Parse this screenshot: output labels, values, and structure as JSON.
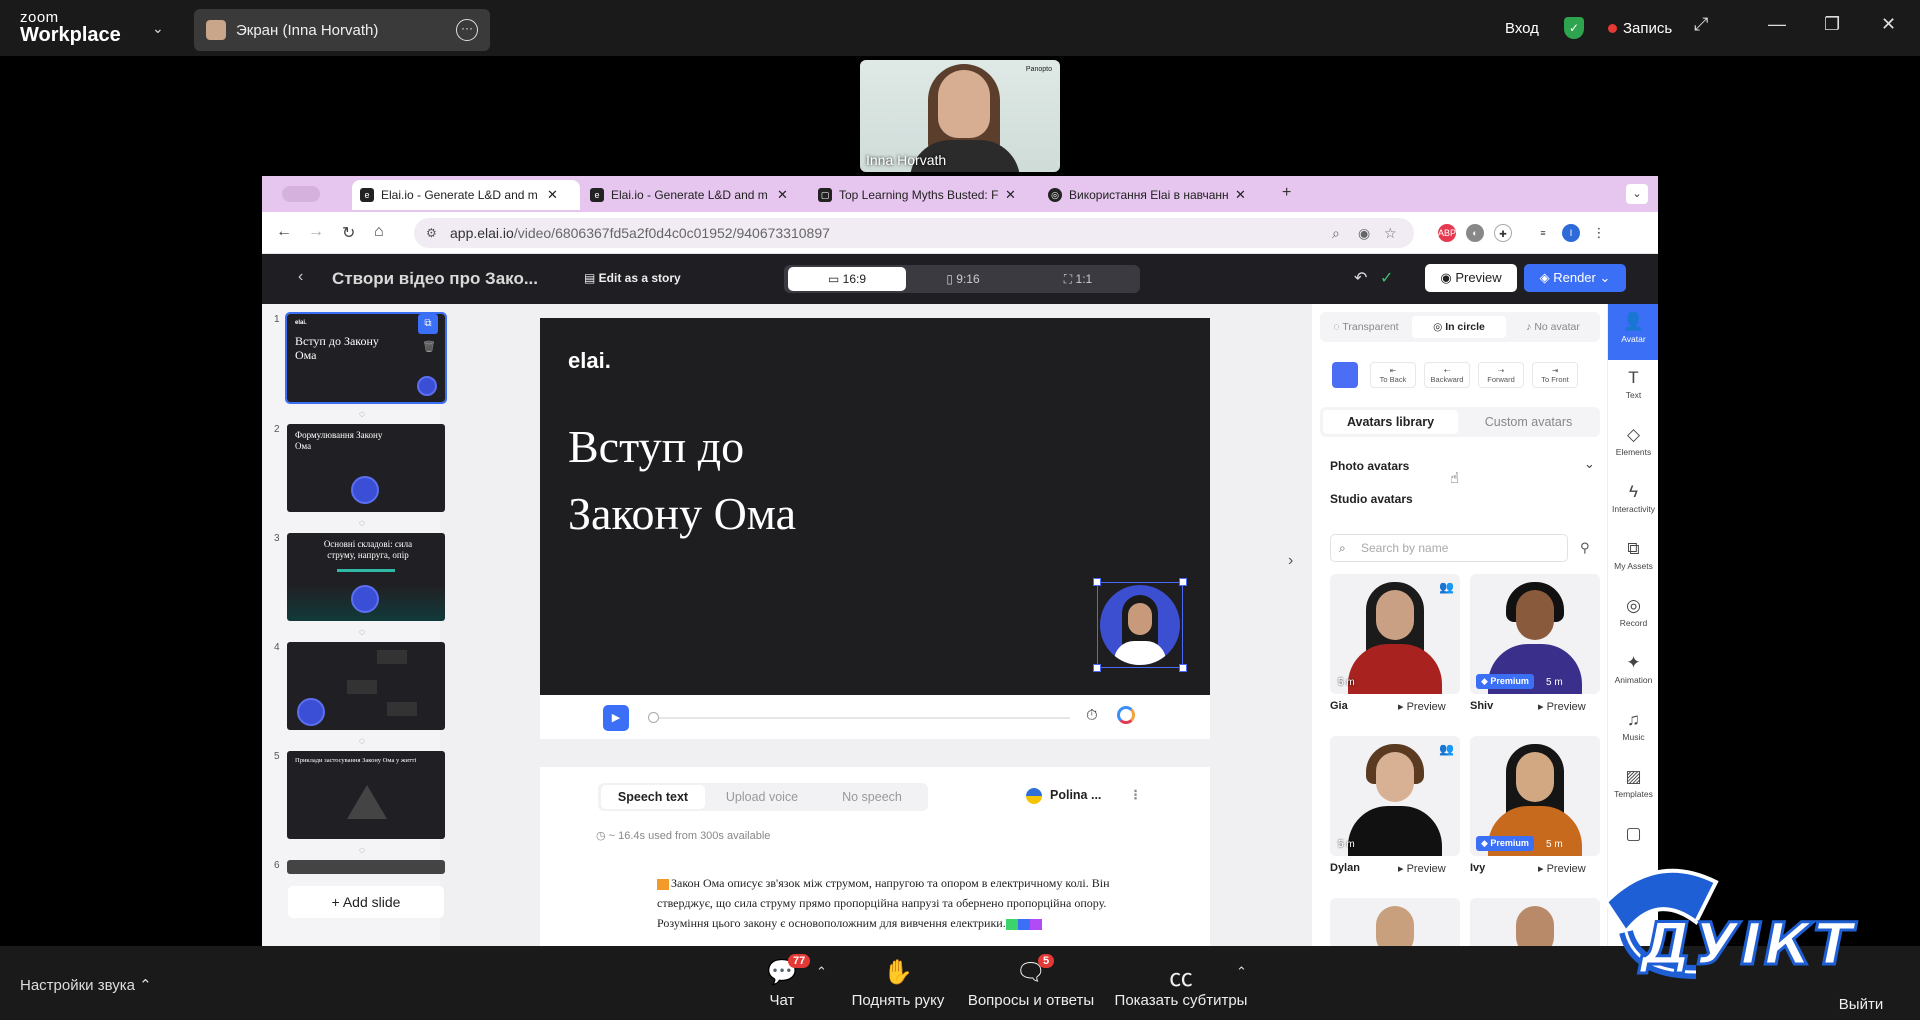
{
  "zoom": {
    "logo_line1": "zoom",
    "logo_line2": "Workplace",
    "screen_share_label": "Экран (Inna Horvath)",
    "signin": "Вход",
    "record": "Запись",
    "participant_name": "Inna Horvath",
    "participant_logo": "Panopto",
    "audio_settings": "Настройки звука",
    "chat_label": "Чат",
    "chat_badge": "77",
    "raise_hand": "Поднять руку",
    "qa_label": "Вопросы и ответы",
    "qa_badge": "5",
    "captions": "Показать субтитры",
    "leave": "Выйти",
    "watermark_text": "ДУІКТ"
  },
  "browser": {
    "tabs": [
      {
        "label": "Elai.io - Generate L&D and m"
      },
      {
        "label": "Elai.io - Generate L&D and m"
      },
      {
        "label": "Top Learning Myths Busted: F"
      },
      {
        "label": "Використання Elai в навчанні"
      }
    ],
    "url_host": "app.elai.io",
    "url_path": "/video/6806367fd5a2f0d4c0c01952/940673310897"
  },
  "app": {
    "title": "Створи відео про Зако...",
    "edit_story": "Edit as a story",
    "ratios": [
      "16:9",
      "9:16",
      "1:1"
    ],
    "preview": "Preview",
    "render": "Render",
    "add_slide": "Add slide",
    "slides": [
      {
        "num": "1",
        "text": "Вступ до Закону Ома"
      },
      {
        "num": "2",
        "text": "Формулювання Закону Ома"
      },
      {
        "num": "3",
        "text": "Основні складові: сила струму, напруга, опір"
      },
      {
        "num": "4",
        "text": ""
      },
      {
        "num": "5",
        "text": "Приклади застосування Закону Ома у житті"
      },
      {
        "num": "6",
        "text": ""
      }
    ],
    "canvas": {
      "logo": "elai.",
      "title_line1": "Вступ до",
      "title_line2": "Закону Ома"
    },
    "speech": {
      "tabs": [
        "Speech text",
        "Upload voice",
        "No speech"
      ],
      "voice": "Polina ...",
      "usage": "~ 16.4s used from 300s available",
      "text": "Закон Ома описує зв'язок між струмом, напругою та опором в електричному колі. Він стверджує, що сила струму прямо пропорційна напрузі та обернено пропорційна опору. Розуміння цього закону є основоположним для вивчення електрики."
    },
    "panel": {
      "modes": [
        "Transparent",
        "In circle",
        "No avatar"
      ],
      "order": [
        "To Back",
        "Backward",
        "Forward",
        "To Front"
      ],
      "library_tabs": [
        "Avatars library",
        "Custom avatars"
      ],
      "photo_avatars": "Photo avatars",
      "studio_avatars": "Studio avatars",
      "search_placeholder": "Search by name",
      "premium": "Premium",
      "duration": "5 m",
      "preview": "Preview",
      "avatars": [
        {
          "name": "Gia",
          "premium": false
        },
        {
          "name": "Shiv",
          "premium": true
        },
        {
          "name": "Dylan",
          "premium": false
        },
        {
          "name": "Ivy",
          "premium": true
        }
      ]
    },
    "tools": [
      "Avatar",
      "Text",
      "Elements",
      "Interactivity",
      "My Assets",
      "Record",
      "Animation",
      "Music",
      "Templates"
    ]
  },
  "colors": {
    "accent": "#3b6ff5",
    "tabbar": "#e6c6ef",
    "appbar": "#1f1f23",
    "zoom_bg": "#1a1a1a"
  }
}
